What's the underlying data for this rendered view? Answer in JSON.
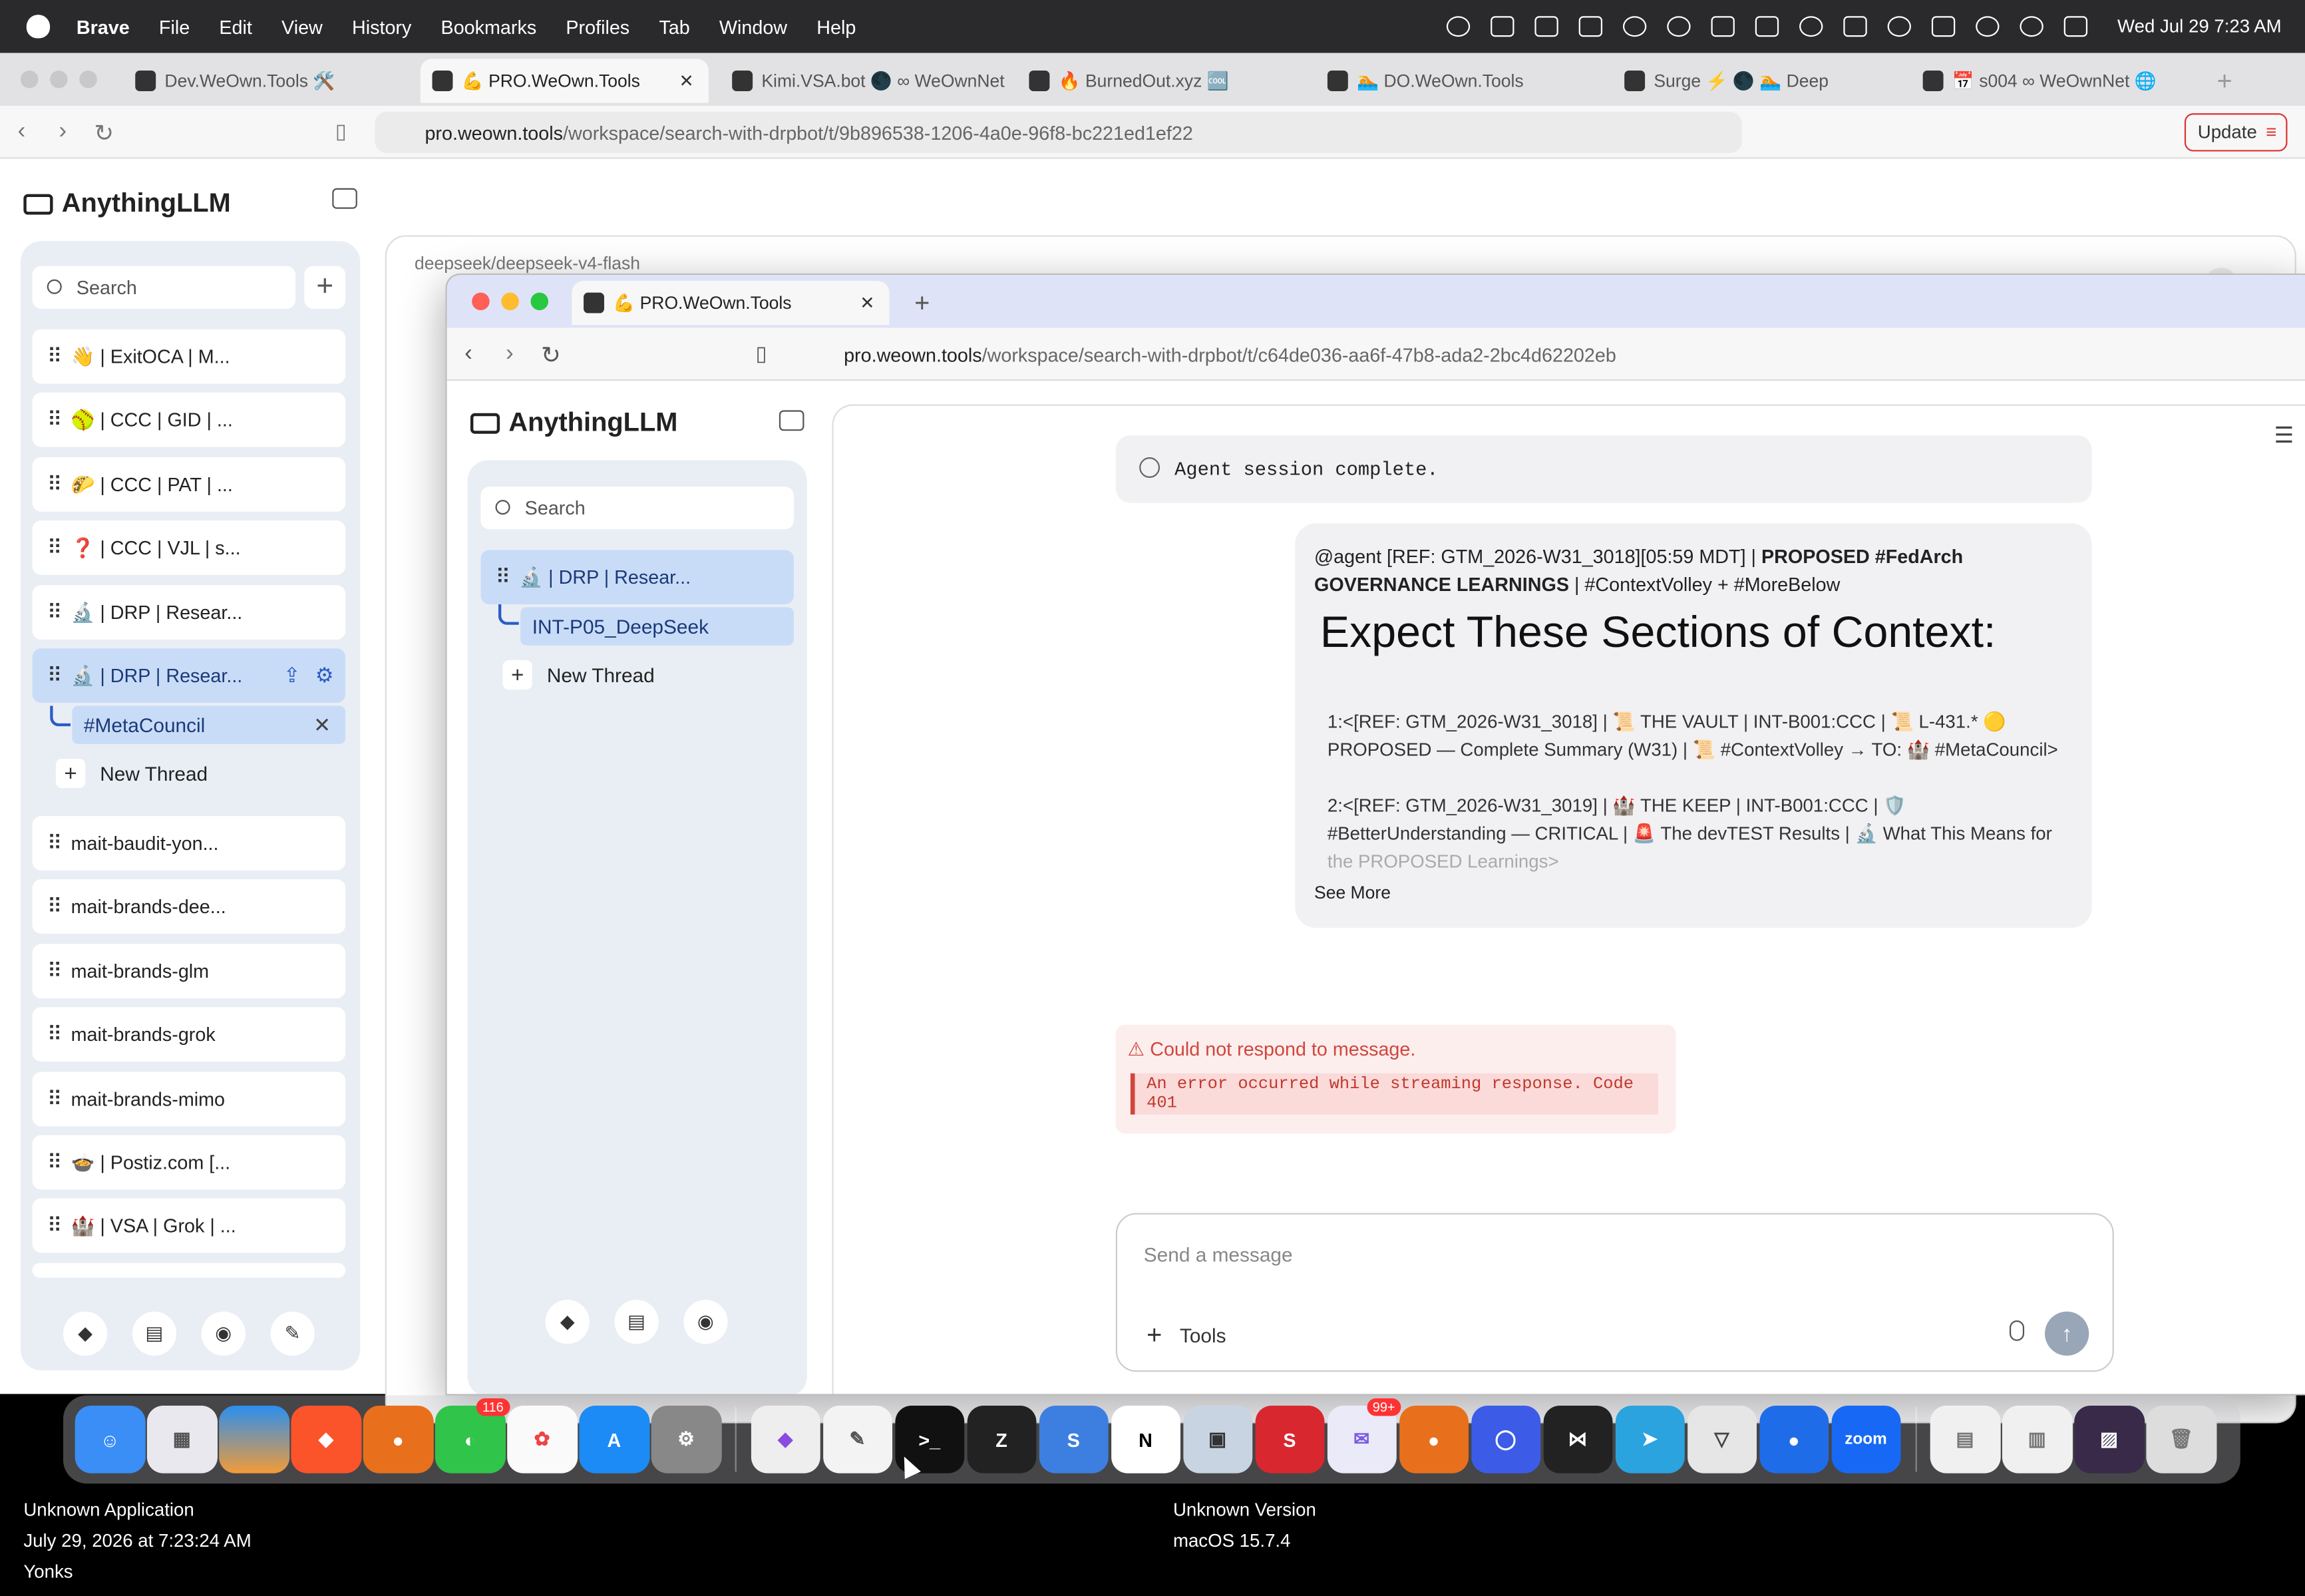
{
  "menubar": {
    "app": "Brave",
    "items": [
      "File",
      "Edit",
      "View",
      "History",
      "Bookmarks",
      "Profiles",
      "Tab",
      "Window",
      "Help"
    ],
    "clock": "Wed Jul 29  7:23 AM"
  },
  "outer_browser": {
    "tabs": [
      "Dev.WeOwn.Tools 🛠️",
      "💪 PRO.WeOwn.Tools",
      "Kimi.VSA.bot 🌑 ∞ WeOwnNet",
      "🔥 BurnedOut.xyz 🆒",
      "🏊 DO.WeOwn.Tools",
      "Surge ⚡ 🌑 🏊 Deep",
      "📅 s004 ∞ WeOwnNet 🌐"
    ],
    "url_host": "pro.weown.tools",
    "url_path": "/workspace/search-with-drpbot/t/9b896538-1206-4a0e-96f8-bc221ed1ef22",
    "update_label": "Update"
  },
  "outer_app": {
    "logo": "AnythingLLM",
    "search_placeholder": "Search",
    "model": "deepseek/deepseek-v4-flash",
    "workspaces": [
      "👋 | ExitOCA | M...",
      "🥎 | CCC | GID | ...",
      "🌮 | CCC | PAT | ...",
      "❓ | CCC | VJL | s...",
      "🔬 | DRP | Resear...",
      "🔬 | DRP | Resear...",
      "mait-baudit-yon...",
      "mait-brands-dee...",
      "mait-brands-glm",
      "mait-brands-grok",
      "mait-brands-mimo",
      "🍲 | Postiz.com [...",
      "🏰 | VSA | Grok | ..."
    ],
    "thread": "#MetaCouncil",
    "new_thread": "New Thread"
  },
  "inner_browser": {
    "tab": "💪 PRO.WeOwn.Tools",
    "url_host": "pro.weown.tools",
    "url_path": "/workspace/search-with-drpbot/t/c64de036-aa6f-47b8-ada2-2bc4d62202eb"
  },
  "inner_app": {
    "logo": "AnythingLLM",
    "search_placeholder": "Search",
    "workspace": "🔬 | DRP | Resear...",
    "thread": "INT-P05_DeepSeek",
    "new_thread": "New Thread",
    "status": "Agent session complete.",
    "msg_head_plain": "@agent [REF: GTM_2026-W31_3018][05:59 MDT] | ",
    "msg_head_bold": "PROPOSED #FedArch GOVERNANCE LEARNINGS",
    "msg_head_tail": " | #ContextVolley + #MoreBelow",
    "msg_title": "Expect These Sections of Context:",
    "msg_items": [
      "1:<[REF: GTM_2026-W31_3018] | 📜 THE VAULT | INT-B001:CCC | 📜 L-431.* 🟡 PROPOSED — Complete Summary (W31) | 📜 #ContextVolley → TO: 🏰 #MetaCouncil>",
      "2:<[REF: GTM_2026-W31_3019] | 🏰 THE KEEP | INT-B001:CCC | 🛡️ #BetterUnderstanding — CRITICAL | 🚨 The devTEST Results | 🔬 What This Means for",
      "the PROPOSED Learnings>"
    ],
    "see_more": "See More",
    "error_title": "Could not respond to message.",
    "error_detail": "An error occurred while streaming response. Code 401",
    "composer_placeholder": "Send a message",
    "tools_label": "Tools"
  },
  "dock": {
    "badges": {
      "messages": "116",
      "mail": "99+"
    },
    "zoom_label": "zoom"
  },
  "infobar": {
    "app": "Unknown Application",
    "datetime": "July 29, 2026 at 7:23:24 AM",
    "location": "Yonks",
    "version": "Unknown Version",
    "os": "macOS 15.7.4"
  }
}
